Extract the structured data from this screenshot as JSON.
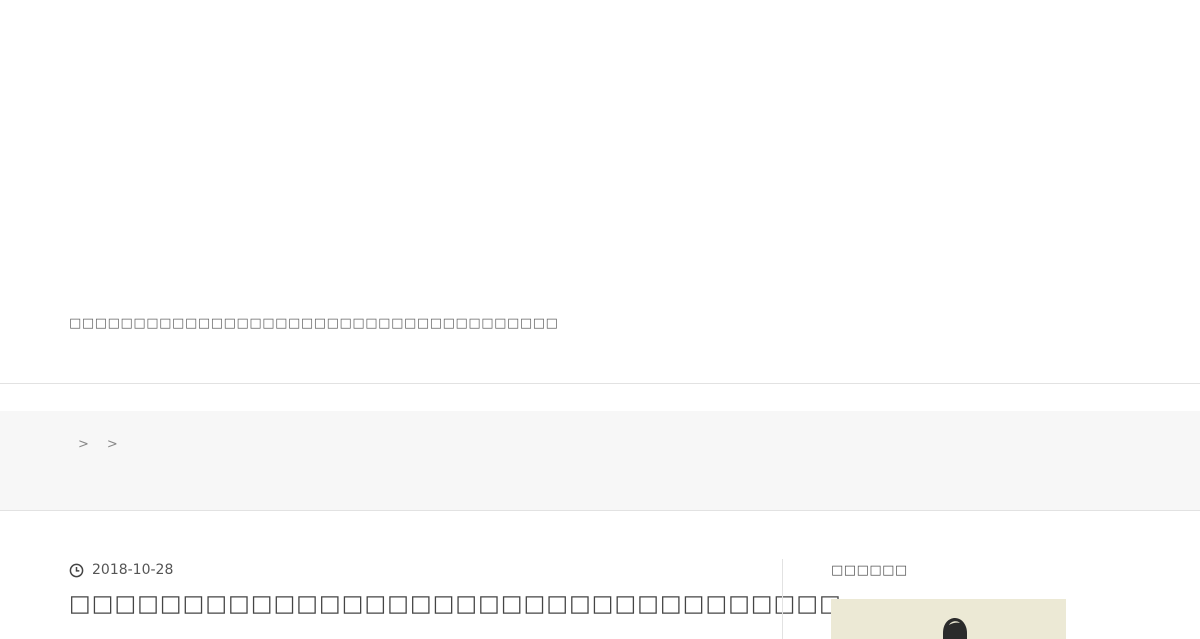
{
  "header": {
    "tagline": "□□□□□□□□□□□□□□□□□□□□□□□□□□□□□□□□□□□□□□"
  },
  "breadcrumb": {
    "items": [
      "",
      "",
      ""
    ],
    "separator": ">"
  },
  "post": {
    "date": "2018-10-28",
    "title": "□□□□□□□□□□□□□□□□□□□□□□□□□□□□□□□□□□"
  },
  "sidebar": {
    "heading": "□□□□□□"
  },
  "colors": {
    "breadcrumb_bg": "#f7f7f7",
    "sidebar_image_bg": "#ece9d5"
  }
}
